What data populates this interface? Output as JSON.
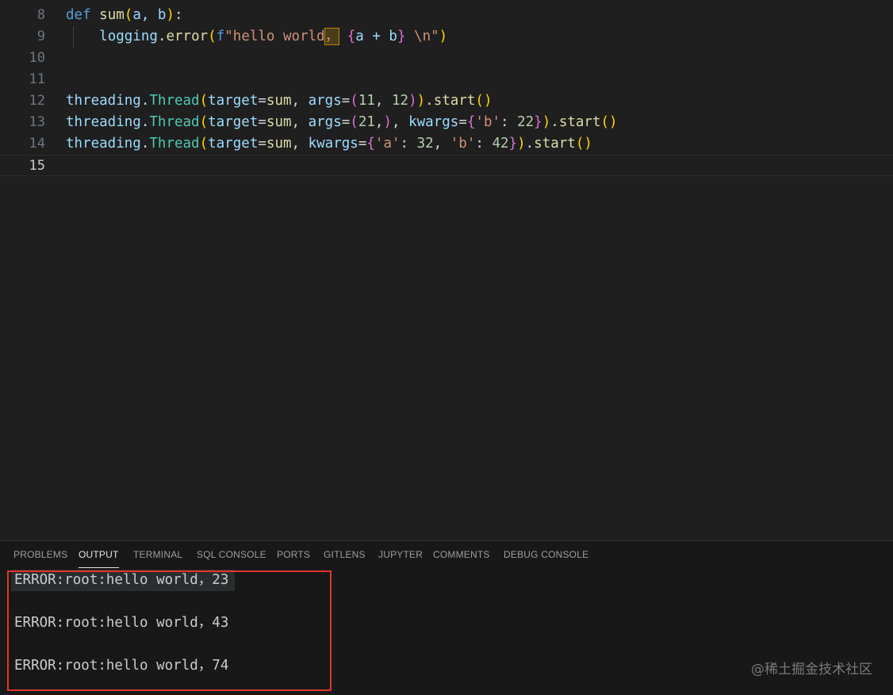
{
  "editor": {
    "lines": [
      {
        "number": "8"
      },
      {
        "number": "9"
      },
      {
        "number": "10"
      },
      {
        "number": "11"
      },
      {
        "number": "12"
      },
      {
        "number": "13"
      },
      {
        "number": "14"
      },
      {
        "number": "15"
      }
    ],
    "tokens": {
      "l8": {
        "def": "def",
        "name": "sum",
        "open": "(",
        "args": "a, b",
        "close": ")",
        "colon": ":"
      },
      "l9": {
        "logging": "logging",
        "dot": ".",
        "error": "error",
        "open": "(",
        "f": "f",
        "str1": "\"hello world",
        "comma_cn": "，",
        "space": " ",
        "brace_open": "{",
        "expr": "a + b",
        "brace_close": "}",
        "str2": " \\n\"",
        "close": ")"
      },
      "l12": {
        "mod": "threading",
        "dot1": ".",
        "cls": "Thread",
        "open": "(",
        "k1": "target",
        "eq1": "=",
        "v1": "sum",
        "c1": ", ",
        "k2": "args",
        "eq2": "=",
        "open2": "(",
        "n1": "11",
        "c2": ", ",
        "n2": "12",
        "close2": ")",
        "close": ")",
        "dot2": ".",
        "start": "start",
        "call": "()"
      },
      "l13": {
        "mod": "threading",
        "dot1": ".",
        "cls": "Thread",
        "open": "(",
        "k1": "target",
        "eq1": "=",
        "v1": "sum",
        "c1": ", ",
        "k2": "args",
        "eq2": "=",
        "open2": "(",
        "n1": "21",
        "c2": ",",
        "close2": ")",
        "c3": ", ",
        "k3": "kwargs",
        "eq3": "=",
        "open3": "{",
        "s1": "'b'",
        "colon": ": ",
        "n2": "22",
        "close3": "}",
        "close": ")",
        "dot2": ".",
        "start": "start",
        "call": "()"
      },
      "l14": {
        "mod": "threading",
        "dot1": ".",
        "cls": "Thread",
        "open": "(",
        "k1": "target",
        "eq1": "=",
        "v1": "sum",
        "c1": ", ",
        "k2": "kwargs",
        "eq2": "=",
        "open2": "{",
        "s1": "'a'",
        "colon1": ": ",
        "n1": "32",
        "c2": ", ",
        "s2": "'b'",
        "colon2": ": ",
        "n2": "42",
        "close2": "}",
        "close": ")",
        "dot2": ".",
        "start": "start",
        "call": "()"
      }
    }
  },
  "panel": {
    "tabs": [
      {
        "label": "PROBLEMS"
      },
      {
        "label": "OUTPUT"
      },
      {
        "label": "TERMINAL"
      },
      {
        "label": "SQL CONSOLE"
      },
      {
        "label": "PORTS"
      },
      {
        "label": "GITLENS"
      },
      {
        "label": "JUPYTER"
      },
      {
        "label": "COMMENTS"
      },
      {
        "label": "DEBUG CONSOLE"
      }
    ],
    "active_tab": "OUTPUT",
    "output_lines": [
      "ERROR:root:hello world，23",
      "ERROR:root:hello world，43",
      "ERROR:root:hello world，74"
    ]
  },
  "watermark": "@稀土掘金技术社区",
  "colors": {
    "editor_bg": "#1f1f1f",
    "panel_bg": "#181818",
    "annotation_box": "#e0352f"
  }
}
